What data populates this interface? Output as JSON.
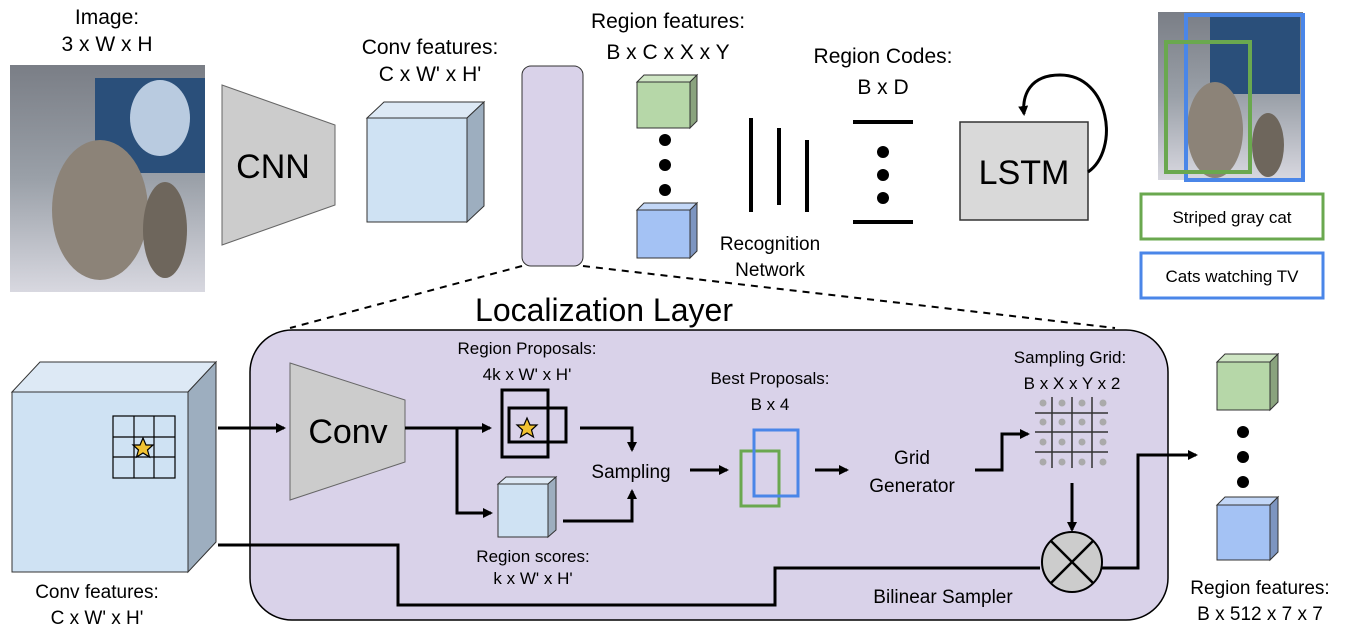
{
  "top": {
    "image_label": "Image:",
    "image_dims": "3 x W x H",
    "cnn_label": "CNN",
    "conv_features_label": "Conv features:",
    "conv_features_dims": "C x W' x H'",
    "region_features_label": "Region features:",
    "region_features_dims": "B x C x X x Y",
    "recognition_label_1": "Recognition",
    "recognition_label_2": "Network",
    "region_codes_label": "Region Codes:",
    "region_codes_dims": "B x D",
    "lstm_label": "LSTM",
    "captions": [
      {
        "text": "Striped gray cat",
        "color": "#6aa84f"
      },
      {
        "text": "Cats watching TV",
        "color": "#4a86e8"
      }
    ]
  },
  "localization": {
    "title": "Localization Layer",
    "input_label": "Conv features:",
    "input_dims": "C x W' x H'",
    "conv_label": "Conv",
    "proposals_label": "Region Proposals:",
    "proposals_dims": "4k x W' x H'",
    "scores_label": "Region scores:",
    "scores_dims": "k x W' x H'",
    "sampling_label": "Sampling",
    "best_label": "Best Proposals:",
    "best_dims": "B x 4",
    "grid_gen_1": "Grid",
    "grid_gen_2": "Generator",
    "grid_label": "Sampling Grid:",
    "grid_dims": "B x X x Y x 2",
    "bilinear_label": "Bilinear Sampler",
    "output_label": "Region features:",
    "output_dims": "B x 512 x 7 x 7"
  },
  "colors": {
    "purple": "#d9d2e9",
    "cube_blue": "#cfe2f3",
    "green_cube": "#b6d7a8",
    "blue_cube": "#a4c2f4",
    "gray": "#cccccc",
    "green": "#6aa84f",
    "blue": "#4a86e8",
    "star": "#f1c232"
  }
}
